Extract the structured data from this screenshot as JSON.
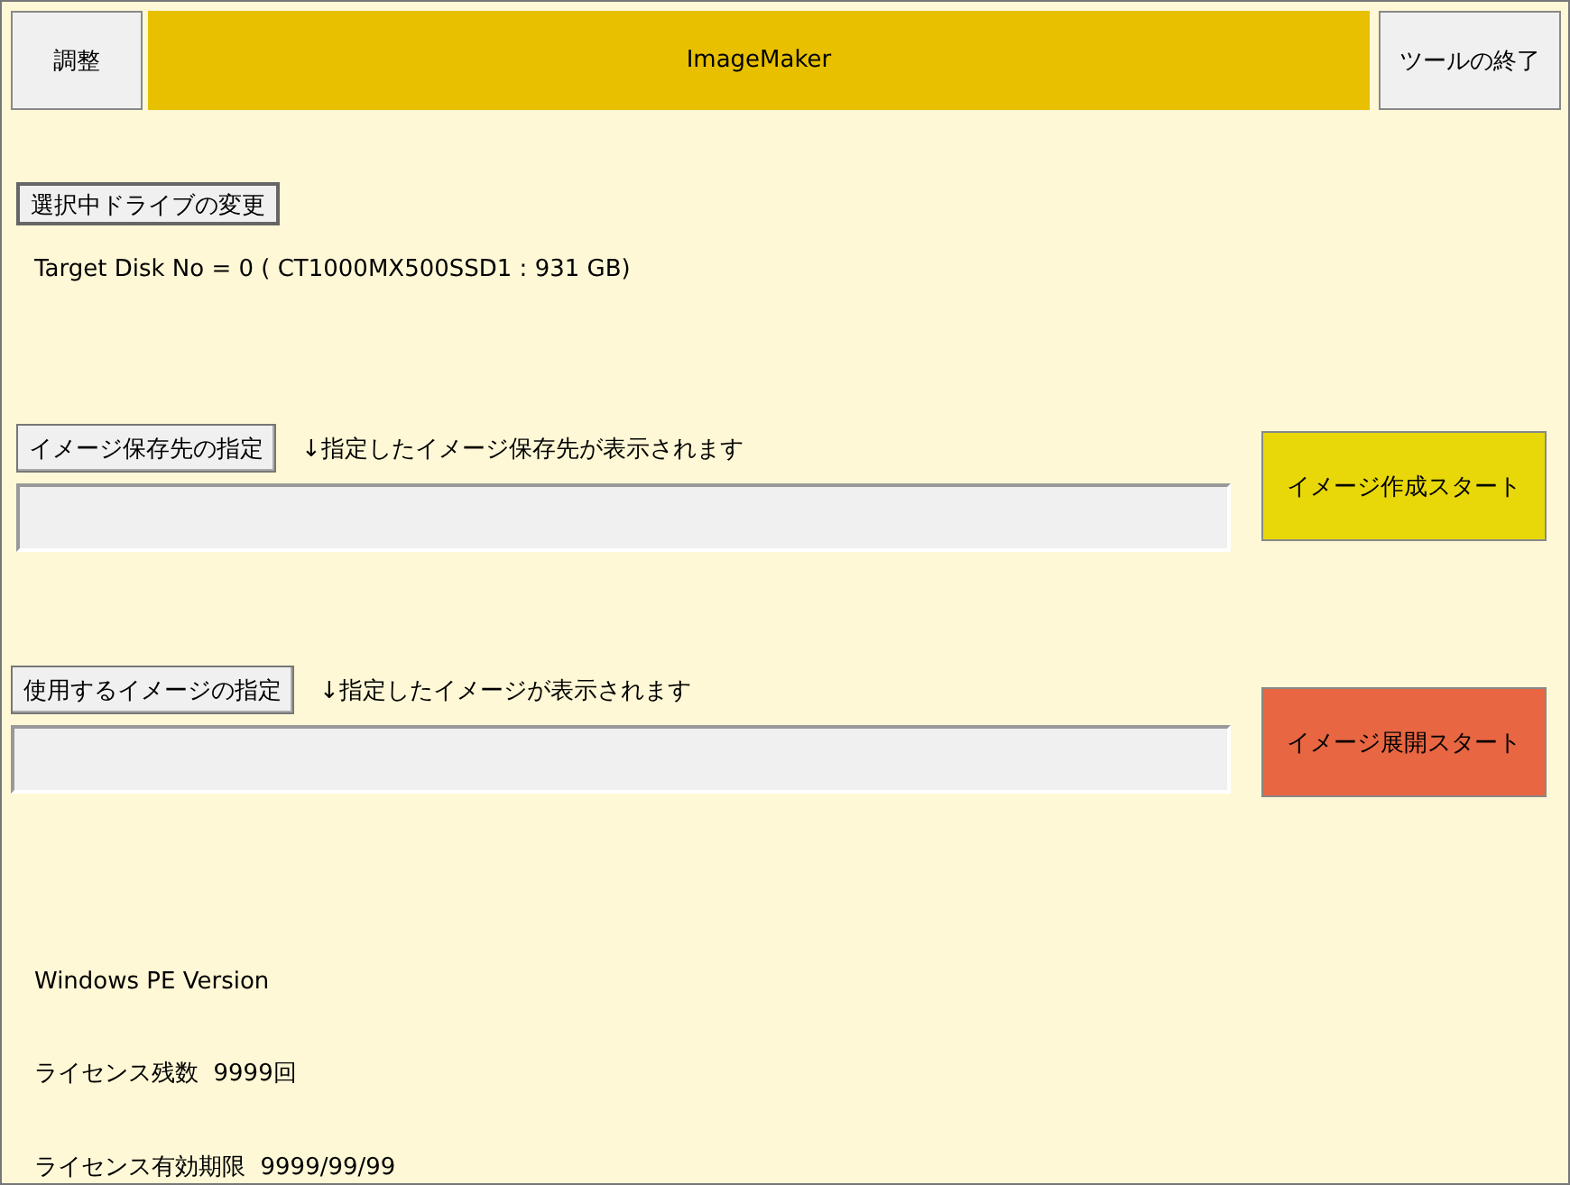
{
  "header": {
    "settings_button": "調整",
    "title": "ImageMaker",
    "exit_button": "ツールの終了"
  },
  "drive": {
    "change_button": "選択中ドライブの変更",
    "target": "Target Disk No = 0 ( CT1000MX500SSD1 : 931 GB)"
  },
  "sections": [
    {
      "kind": "create",
      "select_button": "イメージ保存先の指定",
      "hint": "↓指定したイメージ保存先が表示されます",
      "start_button": "イメージ作成スタート",
      "color": "#e8d80a"
    },
    {
      "kind": "deploy",
      "select_button": "使用するイメージの指定",
      "hint": "↓指定したイメージが表示されます",
      "start_button": "イメージ展開スタート",
      "color": "#e86642"
    }
  ],
  "info": [
    "Windows PE Version",
    "ライセンス残数  9999回",
    "ライセンス有効期限  9999/99/99"
  ]
}
